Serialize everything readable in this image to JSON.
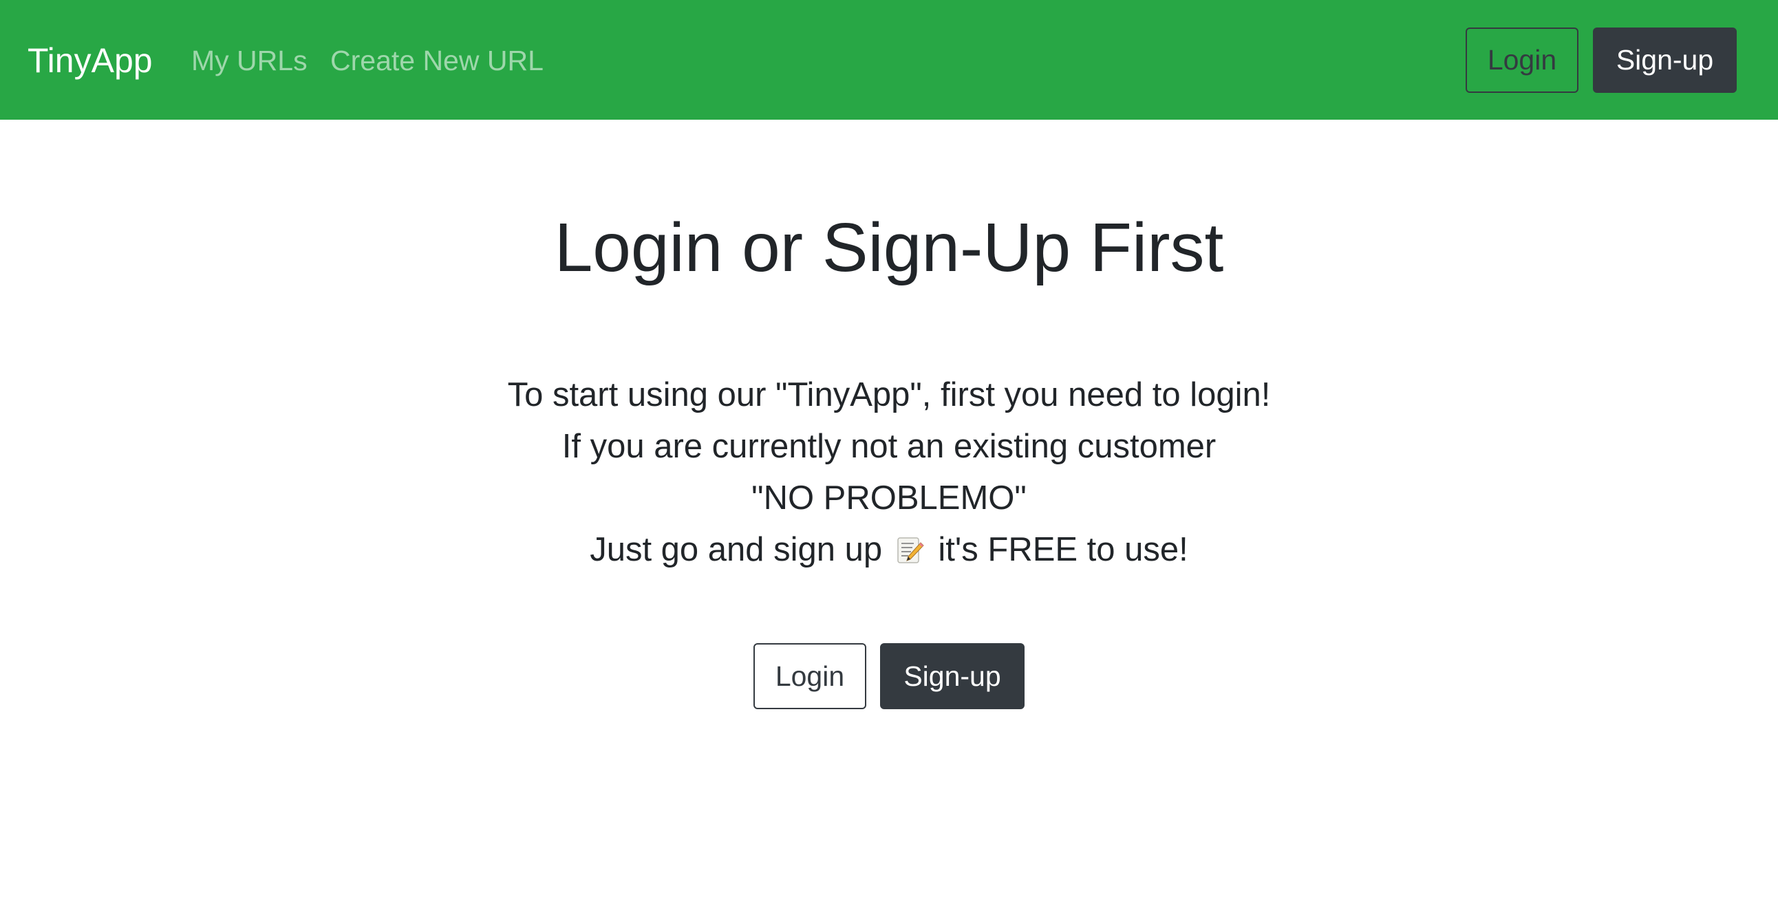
{
  "navbar": {
    "brand": "TinyApp",
    "links": [
      "My URLs",
      "Create New URL"
    ],
    "login_label": "Login",
    "signup_label": "Sign-up",
    "background_color": "#28a745"
  },
  "main": {
    "title": "Login or Sign-Up First",
    "message": {
      "line1_before": "To start using our ",
      "line1_bold": "\"TinyApp\"",
      "line1_after": ", first you need to login!",
      "line2": "If you are currently not an existing customer",
      "line3": "\"NO PROBLEMO\"",
      "line4_before": "Just go and sign up",
      "line4_icon": "memo-icon",
      "line4_after": "it's FREE to use!"
    },
    "login_label": "Login",
    "signup_label": "Sign-up"
  },
  "colors": {
    "dark": "#343a40",
    "text": "#212529"
  }
}
